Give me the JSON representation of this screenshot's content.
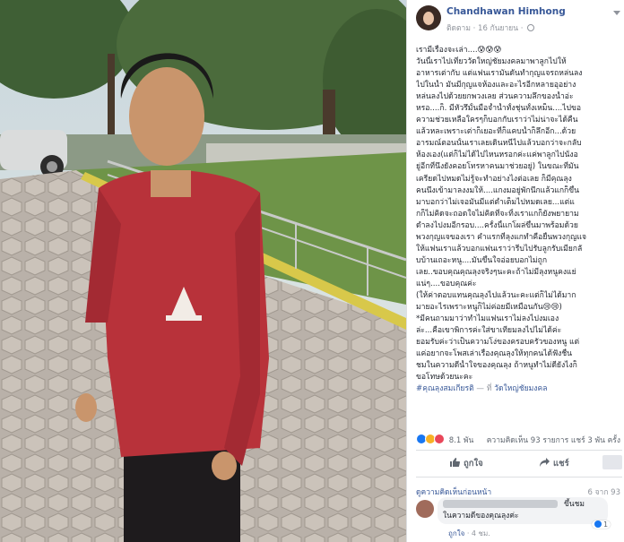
{
  "post": {
    "author": "Chandhawan Himhong",
    "follow": "ติดตาม",
    "date": "16 กันยายน",
    "lines": [
      "เรามีเรื่องจะเล่า....😰😰😰",
      "วันนี้เราไปเที่ยววัดใหญ่ชัยมงคลมาพาลูกไปให้",
      "อาหารเต่ากับ แต่แฟนเรามันดันทำกุญแจรถหล่นลง",
      "ไปในน้ำ มันมีกุญแจห้องและอะไรอีกหลายอุอย่าง",
      "หล่นลงไปด้วยยกพวงเลย ส่วนความลึกของน้ำอ่ะ",
      "หรอ....ก็. มีหัวรึมั้นมือจ้ำน้ำทั้งชุ่นทั้งเหม็น....ไปขอ",
      "ความช่วยเหลือใครๆก็บอกกับเราว่าไม่น่าจะได้คืน",
      "แล้วหละเพราะเต่าก็เยอะที่ก็แคบน้ำก็ลึกอีก...ด้วย",
      "อารมณ์ตอนนั้นเราเลยเดินหนีไปแล้วบอกว่าจะกลับ",
      "ห้องเอง(แต่ก็ไม่ได้ไปไหนหรอกค่ะแค่พาลูกไปนั่งอ",
      "ยู่อีกที่นึงยังคอยโทรหาคนมาช่วยอยู่) ในขณะที่มัน",
      "เครียดไปหมดไม่รู้จะทำอย่างไงต่อเลย ก็มีคุณลุง",
      "คนนึงเข้ามาลงงมให้....แกงมอยู่พักนึกแล้วแกก็ขึ้น",
      "มาบอกว่าไม่เจอมันมีแต่ต่ำเต็มไปหมดเลย...แต่แ",
      "กก็ไม่คิดจะถอดใจไม่คิดที่จะทิ้งเราแกก็ยังพยายาม",
      "ดำลงไปงมอีกรอบ....ครั้งนี้แกโผล่ขึ้นมาพร้อมด้วย",
      "พวงกุญแจของเรา คำแรกที่ลุงแกทำคือยื่นพวงกุญแจ",
      "ให้แฟนเราแล้วบอกแฟนเราว่ารีบไปรับลูกรับเมียกลั",
      "บบ้านเถอะหนู....มันขึ้นใจอ่อยบอกไม่ถูก",
      "เลย..ขอบคุณคุณลุงจริงๆนะคะถ้าไม่มีลุงหนูคงแย่",
      "แน่ๆ....ขอบคุณค่ะ",
      "(ให้ค่าตอบแทนคุณลุงไปแล้วนะคะแต่ก็ไม่ได้มาก",
      "มายอะไรเพราะหนูก็ไม่ค่อยมีเหมือนกัน😢😢)",
      "*มีคนถามมาว่าทำไมแฟนเราไม่ลงไปงมเอง",
      "ล่ะ...คือเขาพิการค่ะใส่ขาเทียมลงไปไม่ได้ค่ะ",
      "ยอมรับค่ะว่าเป็นความโง่ของครอบครัวของหนู แต่",
      "แค่อยากจะโพสเล่าเรื่องคุณลุงให้ทุกคนได้ฟังชื่น",
      "ชมในความดีน้ำใจของคุณลุง ถ้าหนูทำไม่ดียังไงก็",
      "ขอโทษด้วยนะคะ"
    ],
    "hashtag": "#คุณลุงสมเกียรติ",
    "location_prefix": "— ที่",
    "location": "วัดใหญ่ชัยมงคล"
  },
  "stats": {
    "reactions": "8.1 พัน",
    "comments": "ความคิดเห็น 93 รายการ",
    "shares": "แชร์ 3 พัน ครั้ง"
  },
  "actions": {
    "like": "ถูกใจ",
    "share": "แชร์"
  },
  "comments": {
    "header": "ดูความคิดเห็นก่อนหน้า",
    "count": "6 จาก 93",
    "first": {
      "text_end": "ขึ้นชม",
      "text_line2": "ในความดีของคุณลุงค่ะ",
      "likes": "1",
      "like_label": "ถูกใจ",
      "time": "4 ชม."
    }
  },
  "colors": {
    "link": "#385898",
    "like_blue": "#1877f2",
    "shirt_red": "#b8323a"
  }
}
